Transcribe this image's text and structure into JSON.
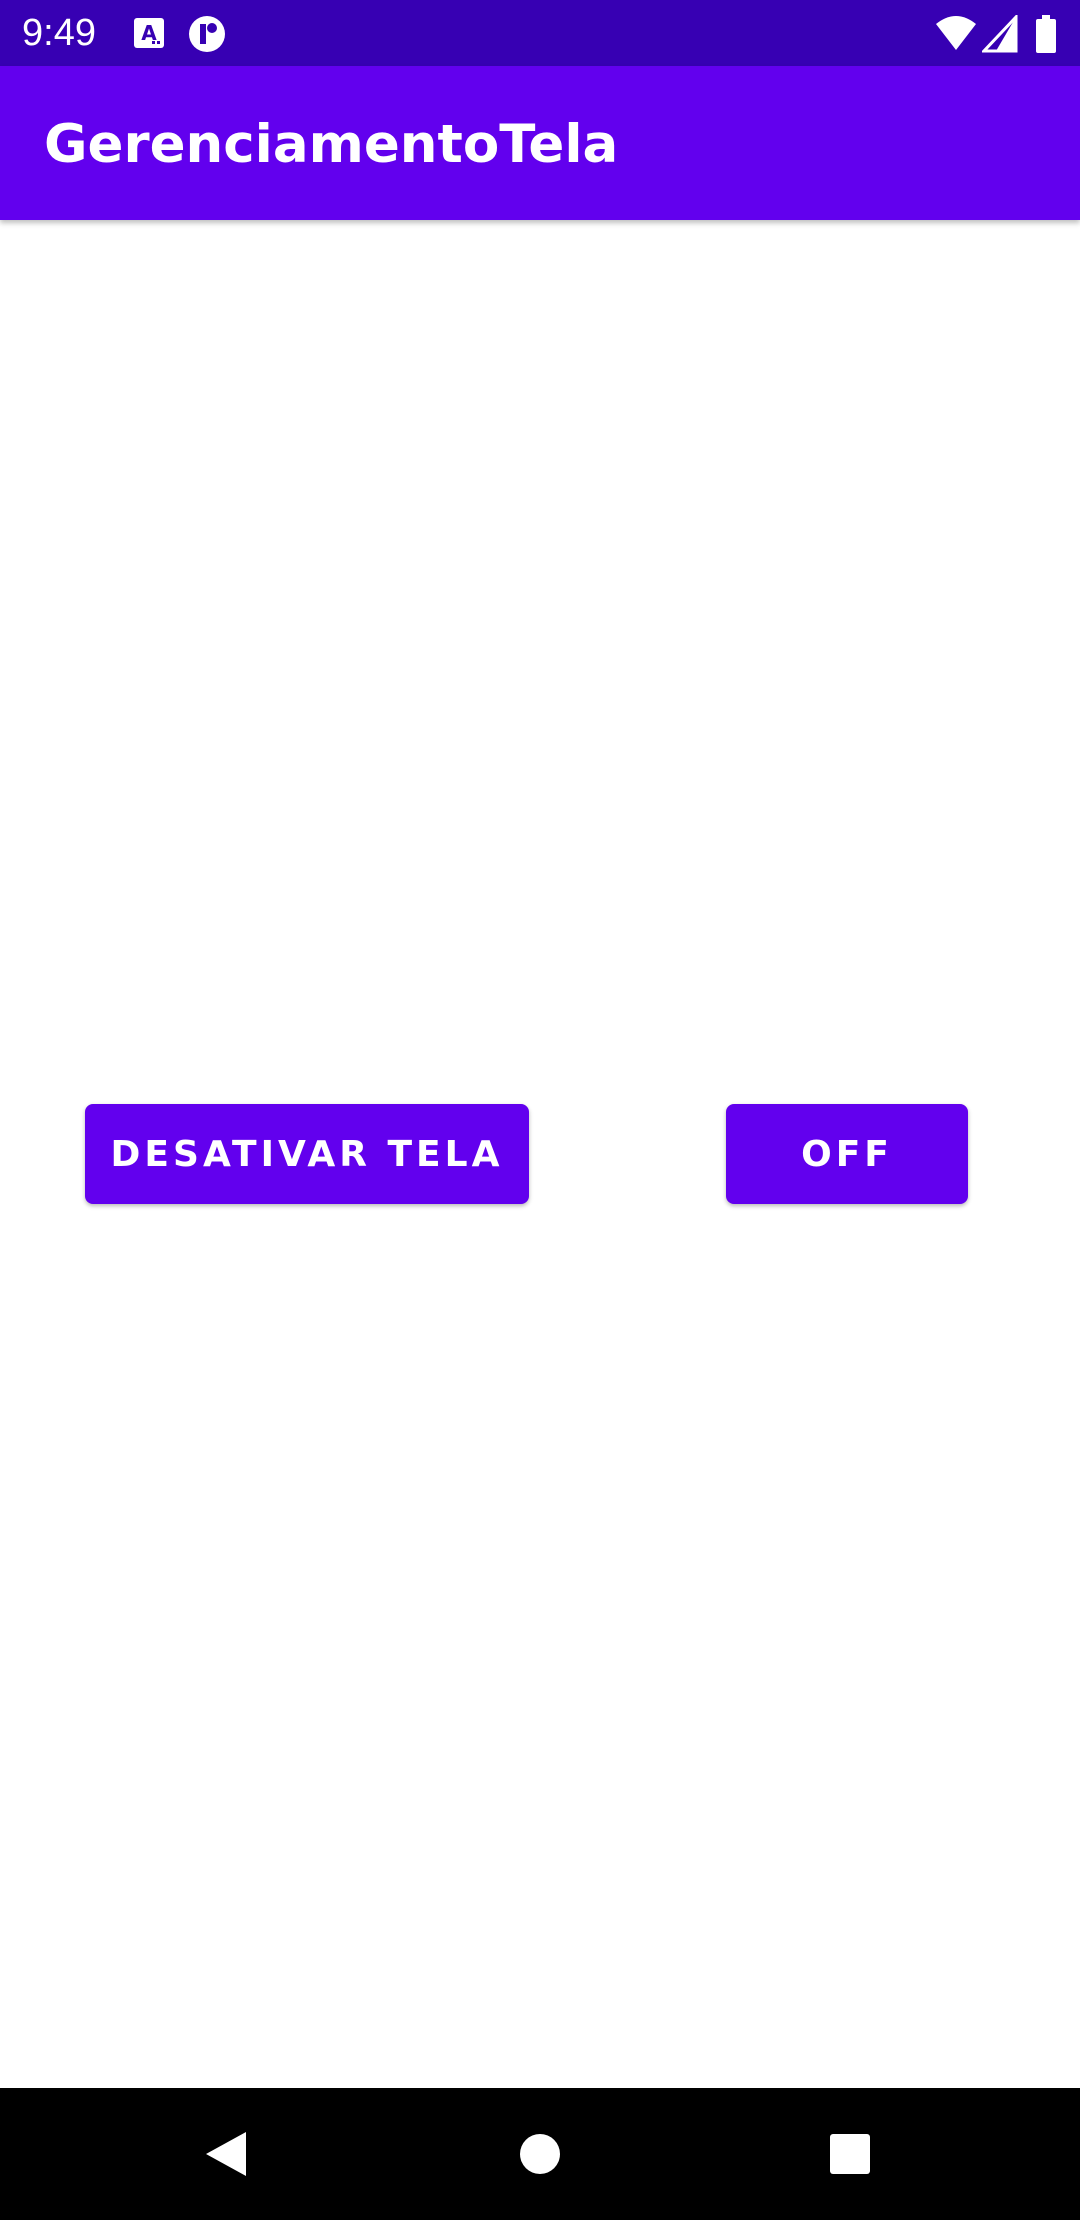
{
  "status_bar": {
    "time": "9:49",
    "background": "#3700B3",
    "icons": [
      "a-notification-icon",
      "r-notification-icon",
      "wifi-icon",
      "signal-icon",
      "battery-icon"
    ]
  },
  "app_bar": {
    "title": "GerenciamentoTela",
    "background": "#6200EE"
  },
  "buttons": {
    "desativar_label": "DESATIVAR TELA",
    "off_label": "OFF",
    "color": "#6200EE"
  },
  "nav_bar": {
    "icons": [
      "back-icon",
      "home-icon",
      "recents-icon"
    ]
  }
}
